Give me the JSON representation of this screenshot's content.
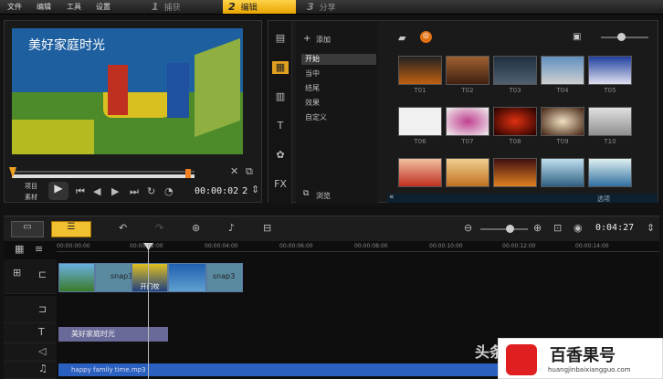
{
  "menu": {
    "file": "文件",
    "edit": "编辑",
    "tools": "工具",
    "settings": "设置"
  },
  "steps": [
    {
      "num": "1",
      "label": "捕获"
    },
    {
      "num": "2",
      "label": "编辑"
    },
    {
      "num": "3",
      "label": "分享"
    }
  ],
  "preview": {
    "title_overlay": "美好家庭时光",
    "mode_project": "项目",
    "mode_clip": "素材",
    "timecode": "00:00:02",
    "timecode_tail": "2"
  },
  "library": {
    "add_label": "添加",
    "categories": [
      "开始",
      "当中",
      "结尾",
      "效果",
      "自定义"
    ],
    "browse_label": "浏览",
    "options_label": "选项",
    "thumb_labels": [
      "T01",
      "T02",
      "T03",
      "T04",
      "T05",
      "T06",
      "T07",
      "T08",
      "T09",
      "T10"
    ]
  },
  "timeline": {
    "total_time": "0:04:27",
    "ruler": [
      "00:00:00:00",
      "00:00:02:00",
      "00:00:04:00",
      "00:00:06:00",
      "00:00:08:00",
      "00:00:10:00",
      "00:00:12:00",
      "00:00:14:00"
    ],
    "clip1": "snap3",
    "clip2": "snap3",
    "title_clip_text": "开门校",
    "text_clip": "美好家庭时光",
    "audio_clip": "happy family time.mp3"
  },
  "watermark": {
    "left": "头条",
    "brand": "百香果号",
    "url": "huangjinbaixiangguo.com"
  }
}
